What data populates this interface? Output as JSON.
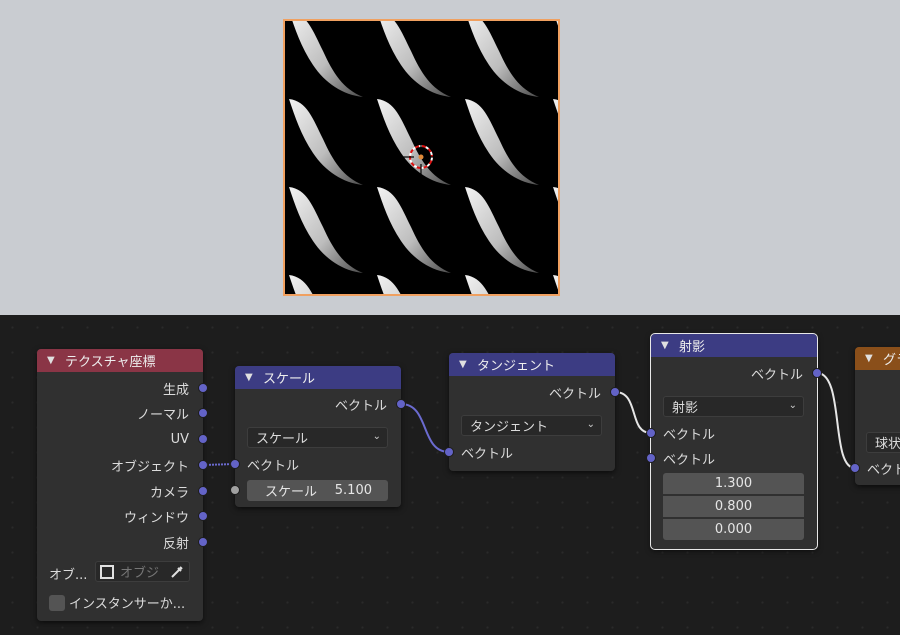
{
  "colors": {
    "viewport_bg": "#c9ccd1",
    "editor_bg": "#1d1d1d",
    "header_texcoord": "#8a3546",
    "header_vector": "#3c3c83",
    "header_gradient": "#8a4f1a",
    "socket_vector": "#6363c7",
    "socket_float": "#a1a1a1",
    "selection_outline": "#f0a060"
  },
  "nodes": {
    "texcoord": {
      "title": "テクスチャ座標",
      "outputs": [
        "生成",
        "ノーマル",
        "UV",
        "オブジェクト",
        "カメラ",
        "ウィンドウ",
        "反射"
      ],
      "object_label": "オブ...",
      "object_placeholder": "オブジ",
      "instancer_label": "インスタンサーか..."
    },
    "scale": {
      "title": "スケール",
      "output": "ベクトル",
      "operation": "スケール",
      "input_vector": "ベクトル",
      "scale_label": "スケール",
      "scale_value": "5.100"
    },
    "tangent": {
      "title": "タンジェント",
      "output": "ベクトル",
      "operation": "タンジェント",
      "input_vector": "ベクトル"
    },
    "project": {
      "title": "射影",
      "output": "ベクトル",
      "operation": "射影",
      "input_a": "ベクトル",
      "input_b": "ベクトル",
      "values": [
        "1.300",
        "0.800",
        "0.000"
      ]
    },
    "gradient": {
      "title": "グラ",
      "dropdown": "球状",
      "input_vector": "ベクトル"
    }
  }
}
